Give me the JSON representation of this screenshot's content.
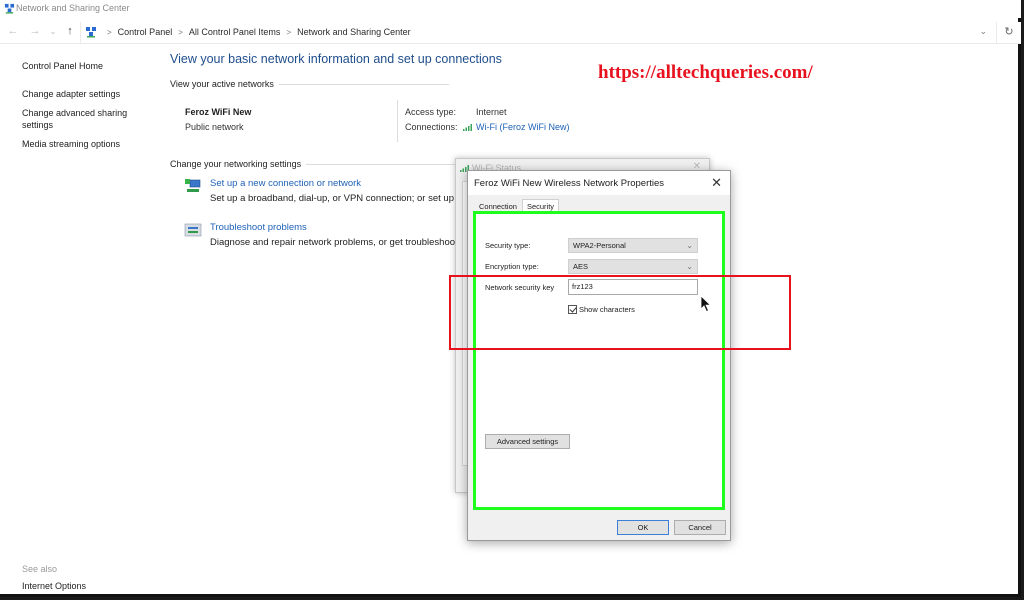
{
  "window": {
    "title": "Network and Sharing Center"
  },
  "nav": {
    "back_icon": "arrow-left-icon",
    "forward_icon": "arrow-right-icon",
    "recent_icon": "chevron-down-icon",
    "up_icon": "arrow-up-icon",
    "breadcrumbs": [
      "Control Panel",
      "All Control Panel Items",
      "Network and Sharing Center"
    ],
    "refresh_icon": "refresh-icon"
  },
  "sidebar": {
    "home": "Control Panel Home",
    "items": [
      {
        "label": "Change adapter settings"
      },
      {
        "label": "Change advanced sharing settings"
      },
      {
        "label": "Media streaming options"
      }
    ],
    "see_also": "See also",
    "see_also_items": [
      {
        "label": "Internet Options"
      }
    ]
  },
  "main": {
    "title": "View your basic network information and set up connections",
    "active_networks_label": "View your active networks",
    "network": {
      "name": "Feroz WiFi New",
      "type": "Public network",
      "access_type_label": "Access type:",
      "access_type_value": "Internet",
      "connections_label": "Connections:",
      "connections_value": "Wi-Fi (Feroz WiFi New)"
    },
    "change_settings_label": "Change your networking settings",
    "tasks": [
      {
        "link": "Set up a new connection or network",
        "desc": "Set up a broadband, dial-up, or VPN connection; or set up a r"
      },
      {
        "link": "Troubleshoot problems",
        "desc": "Diagnose and repair network problems, or get troubleshootir"
      }
    ]
  },
  "watermark": "https://alltechqueries.com/",
  "back_dialog": {
    "title": "Wi-Fi Status"
  },
  "dialog": {
    "title": "Feroz WiFi New Wireless Network Properties",
    "tabs": [
      {
        "label": "Connection",
        "active": false
      },
      {
        "label": "Security",
        "active": true
      }
    ],
    "security_type_label": "Security type:",
    "security_type_value": "WPA2-Personal",
    "encryption_type_label": "Encryption type:",
    "encryption_type_value": "AES",
    "network_key_label": "Network security key",
    "network_key_value": "frz123",
    "show_characters_label": "Show characters",
    "show_characters_checked": true,
    "advanced_settings_label": "Advanced settings",
    "ok_label": "OK",
    "cancel_label": "Cancel"
  },
  "annotations": {
    "green_color": "#1eff1e",
    "red_color": "#e8121e"
  }
}
